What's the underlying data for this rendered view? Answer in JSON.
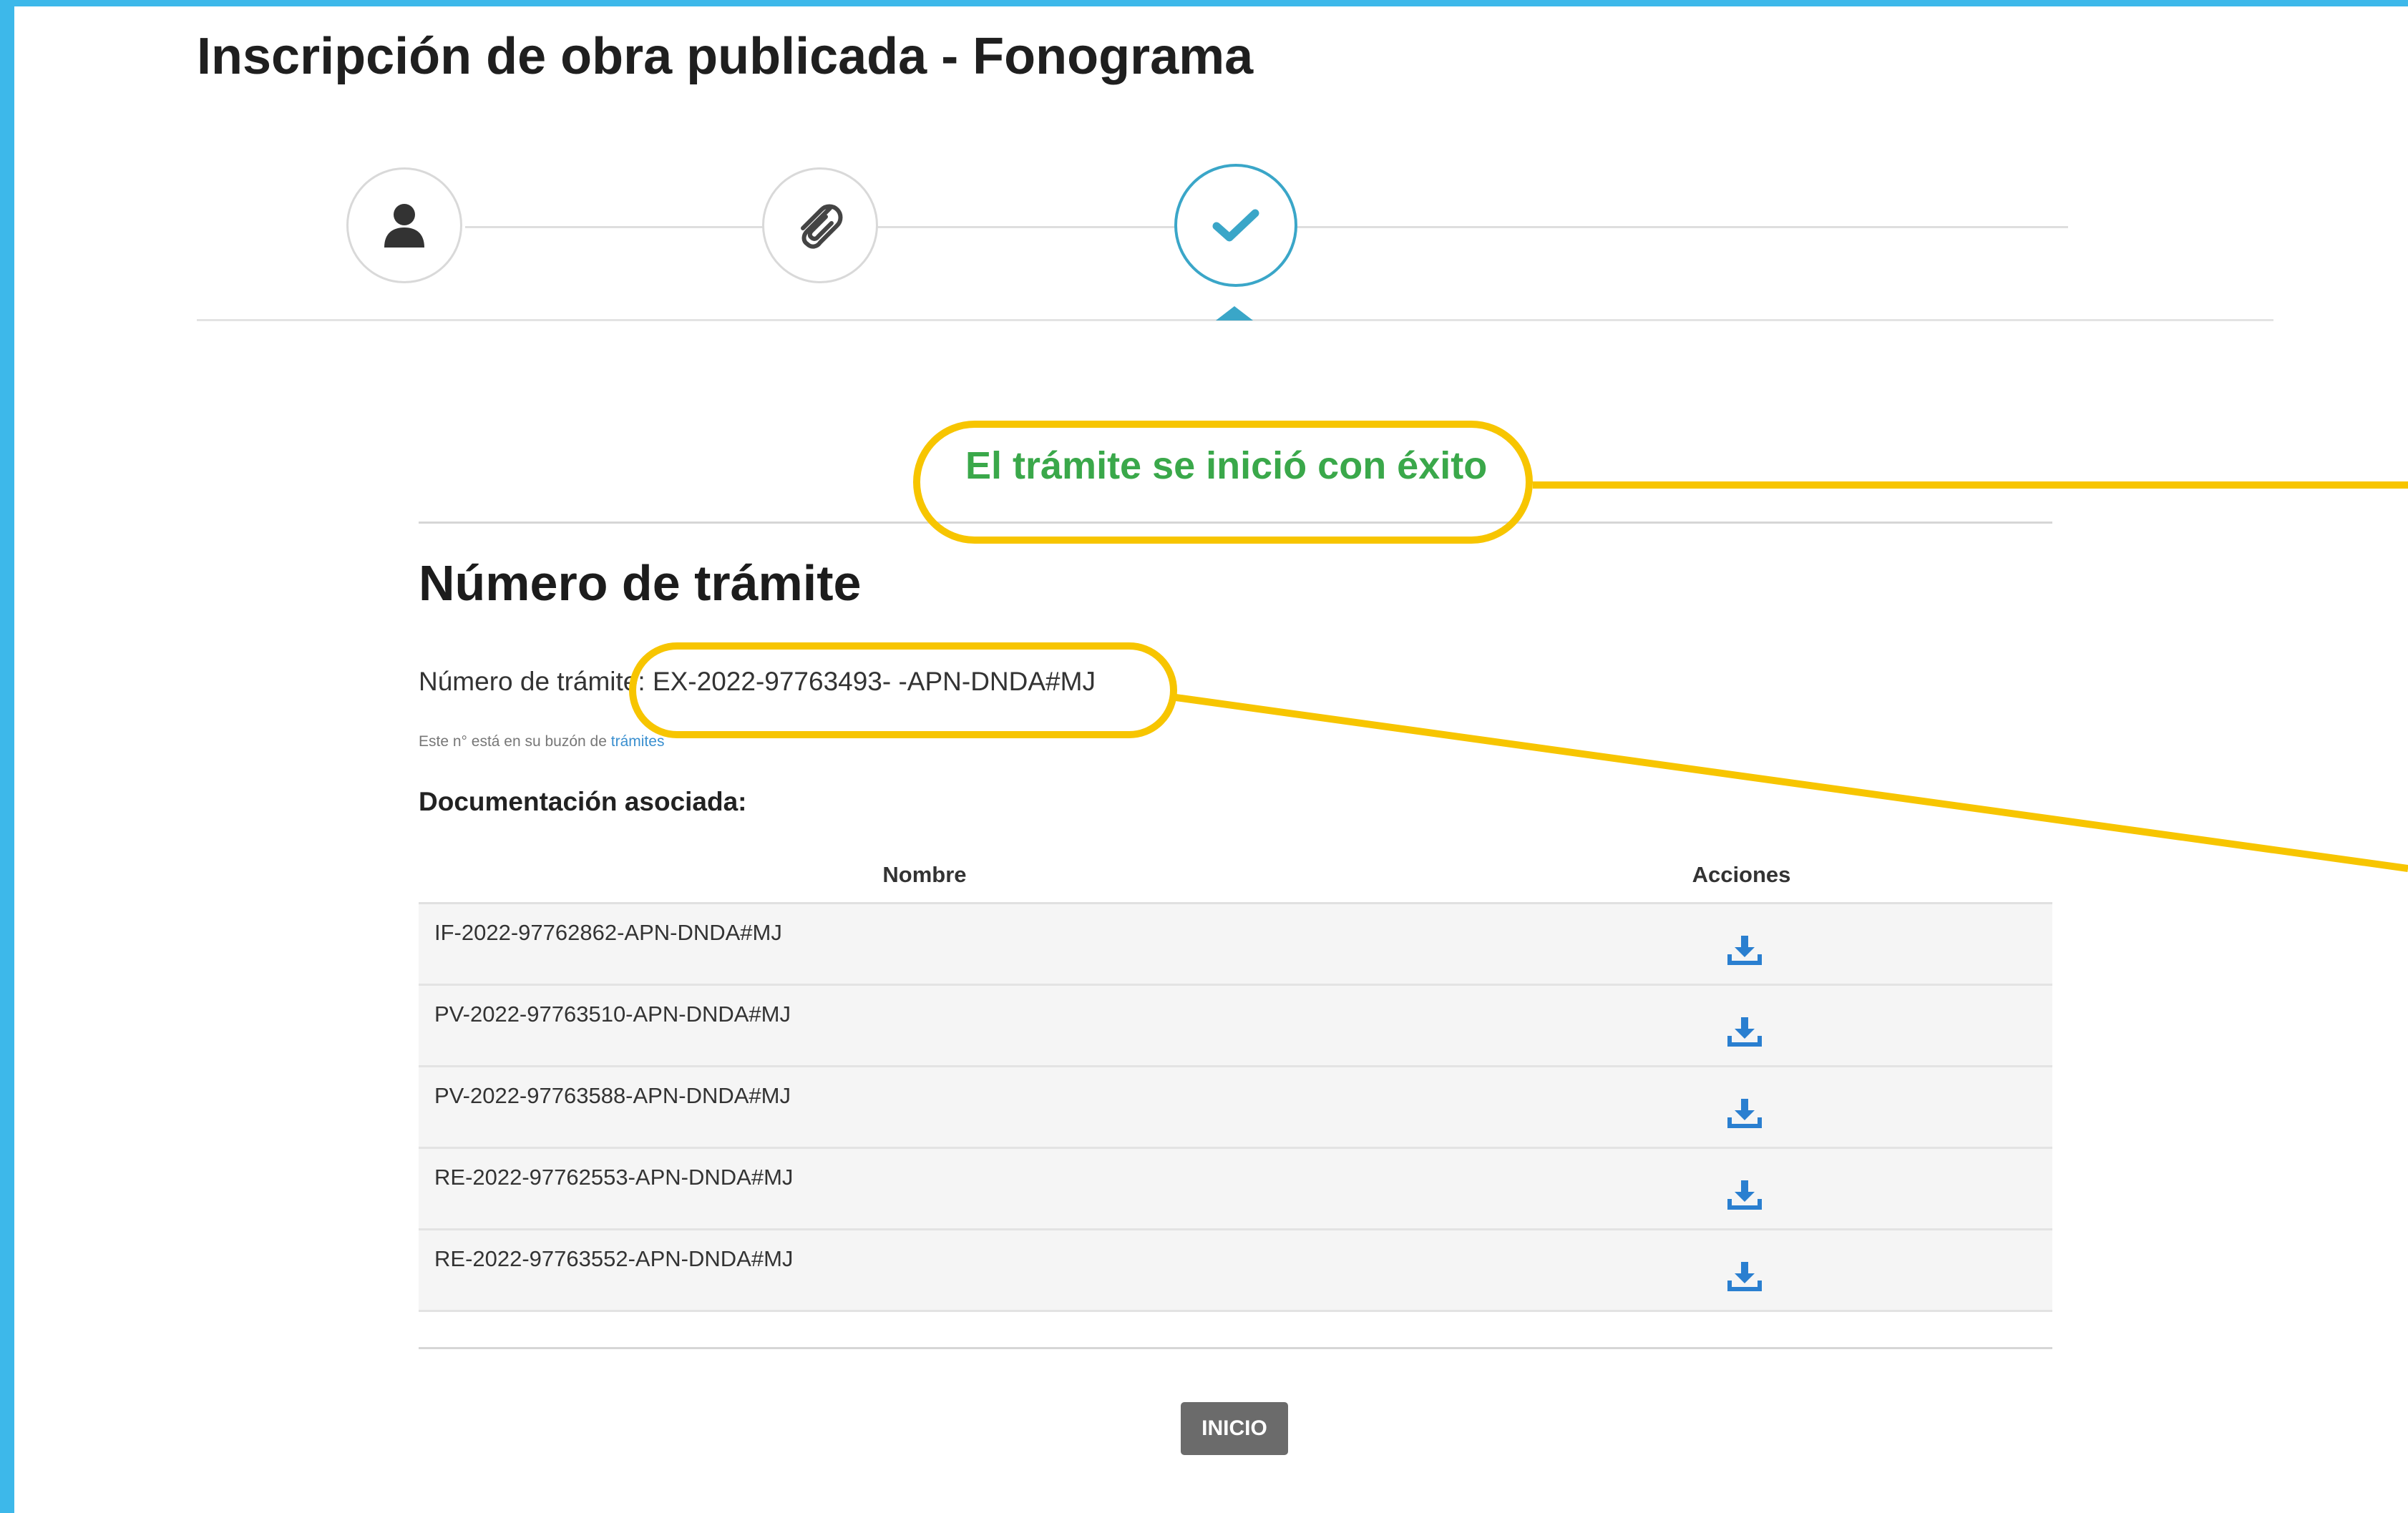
{
  "page": {
    "title": "Inscripción de obra publicada - Fonograma"
  },
  "stepper": {
    "steps": [
      {
        "icon": "user-icon",
        "state": "done"
      },
      {
        "icon": "paperclip-icon",
        "state": "done"
      },
      {
        "icon": "check-icon",
        "state": "active"
      }
    ],
    "accent_color": "#3aa6c8"
  },
  "result": {
    "success_message": "El trámite se inició con éxito",
    "success_color": "#3aa84a",
    "section_title": "Número de trámite",
    "tramite_label": "Número de trámite:",
    "tramite_number": "EX-2022-97763493- -APN-DNDA#MJ",
    "note_text": "Este n° está en su buzón de",
    "note_link": "trámites",
    "docs_label": "Documentación asociada:"
  },
  "docs_table": {
    "headers": {
      "name": "Nombre",
      "actions": "Acciones"
    },
    "rows": [
      {
        "name": "IF-2022-97762862-APN-DNDA#MJ",
        "action_icon": "download-icon"
      },
      {
        "name": "PV-2022-97763510-APN-DNDA#MJ",
        "action_icon": "download-icon"
      },
      {
        "name": "PV-2022-97763588-APN-DNDA#MJ",
        "action_icon": "download-icon"
      },
      {
        "name": "RE-2022-97762553-APN-DNDA#MJ",
        "action_icon": "download-icon"
      },
      {
        "name": "RE-2022-97763552-APN-DNDA#MJ",
        "action_icon": "download-icon"
      }
    ]
  },
  "buttons": {
    "inicio": "INICIO"
  },
  "annotations": {
    "highlight_color": "#f7c500"
  }
}
